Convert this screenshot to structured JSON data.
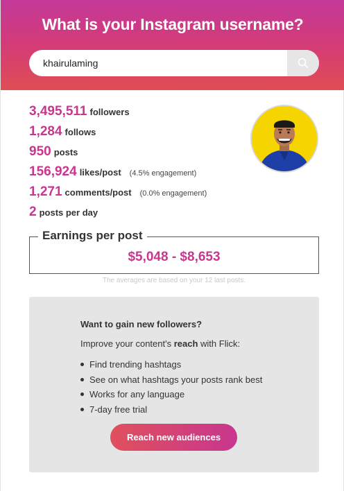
{
  "header": {
    "title": "What is your Instagram username?",
    "search_value": "khairulaming",
    "search_icon": "search-icon"
  },
  "stats": [
    {
      "value": "3,495,511",
      "label": "followers",
      "extra": ""
    },
    {
      "value": "1,284",
      "label": "follows",
      "extra": ""
    },
    {
      "value": "950",
      "label": "posts",
      "extra": ""
    },
    {
      "value": "156,924",
      "label": "likes/post",
      "extra": "(4.5% engagement)"
    },
    {
      "value": "1,271",
      "label": "comments/post",
      "extra": "(0.0% engagement)"
    },
    {
      "value": "2",
      "label": "posts per day",
      "extra": ""
    }
  ],
  "earnings": {
    "title": "Earnings per post",
    "value": "$5,048 - $8,653",
    "footnote": "The averages are based on your 12 last posts."
  },
  "promo": {
    "heading": "Want to gain new followers?",
    "text_before": "Improve your content's ",
    "text_bold": "reach",
    "text_after": " with Flick:",
    "items": [
      "Find trending hashtags",
      "See on what hashtags your posts rank best",
      "Works for any language",
      "7-day free trial"
    ],
    "cta_label": "Reach new audiences"
  },
  "colors": {
    "accent": "#c8368f",
    "header_gradient_top": "#c4399a",
    "header_gradient_bottom": "#e04e54",
    "promo_bg": "#e5e5e5"
  }
}
